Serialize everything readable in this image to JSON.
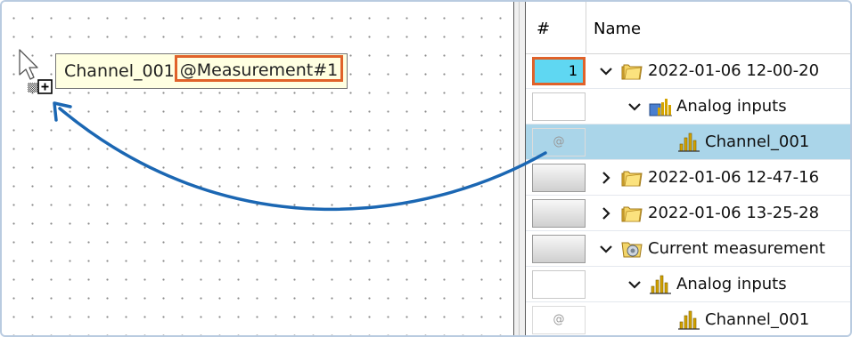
{
  "canvas": {
    "tooltip": {
      "channel": "Channel_001",
      "measurement_ref": "@Measurement#1"
    }
  },
  "tree": {
    "columns": {
      "index": "#",
      "name": "Name"
    },
    "rows": [
      {
        "cell": "1",
        "cell_style": "selected-index",
        "expander": "expanded",
        "icon": "folder-icon",
        "label": "2022-01-06 12-00-20"
      },
      {
        "cell": "",
        "cell_style": "empty",
        "expander": "expanded",
        "icon": "analog-inputs-group-icon",
        "label": "Analog inputs"
      },
      {
        "cell": "@",
        "cell_style": "at",
        "expander": "none",
        "icon": "channel-icon",
        "label": "Channel_001",
        "selected": true
      },
      {
        "cell": "",
        "cell_style": "button",
        "expander": "collapsed",
        "icon": "folder-icon",
        "label": "2022-01-06 12-47-16"
      },
      {
        "cell": "",
        "cell_style": "button",
        "expander": "collapsed",
        "icon": "folder-icon",
        "label": "2022-01-06 13-25-28"
      },
      {
        "cell": "",
        "cell_style": "button",
        "expander": "expanded",
        "icon": "current-measurement-icon",
        "label": "Current measurement"
      },
      {
        "cell": "",
        "cell_style": "empty",
        "expander": "expanded",
        "icon": "channel-icon",
        "label": "Analog inputs"
      },
      {
        "cell": "@",
        "cell_style": "at",
        "expander": "none",
        "icon": "channel-icon",
        "label": "Channel_001"
      }
    ]
  },
  "colors": {
    "highlight_border": "#e0622a",
    "selected_row": "#aad5e9",
    "index_cell": "#5fd7f2",
    "arrow": "#1b67b3"
  }
}
